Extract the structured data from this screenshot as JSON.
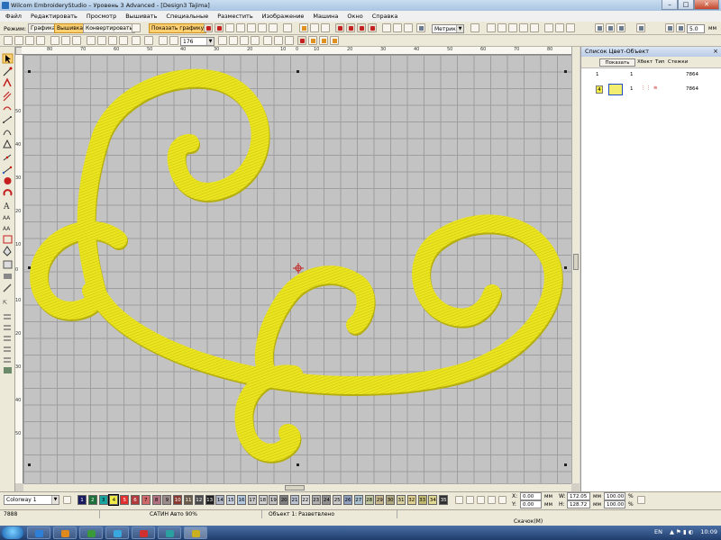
{
  "window": {
    "title": "Wilcom EmbroideryStudio – Уровень 3 Advanced - [Design3      Tajima]",
    "controls": [
      "–",
      "□",
      "✕"
    ]
  },
  "menu": [
    "Файл",
    "Редактировать",
    "Просмотр",
    "Вышивать",
    "Специальные",
    "Разместить",
    "Изображение",
    "Машина",
    "Окно",
    "Справка"
  ],
  "toolbar": {
    "mode_label": "Режим:",
    "modes": [
      "Графика",
      "Вышивка",
      "Конвертировать"
    ],
    "active_mode": "Вышивка",
    "show_graphics": "Показать графику",
    "zoom_value": "176",
    "units": "Метрика",
    "units_suffix": "мм",
    "units_value": "5.0"
  },
  "rulers": {
    "top": [
      "80",
      "70",
      "60",
      "50",
      "40",
      "30",
      "20",
      "10",
      "0",
      "10",
      "20",
      "30",
      "40",
      "50",
      "60",
      "70",
      "80"
    ],
    "left": [
      "50",
      "40",
      "30",
      "20",
      "10",
      "0",
      "10",
      "20",
      "30",
      "40",
      "50"
    ]
  },
  "right_panel": {
    "title": "Список Цвет-Объект",
    "show_button": "Показать",
    "columns": [
      "Хбект",
      "Тип",
      "Стежки"
    ],
    "rows": [
      {
        "col1": "1",
        "col2": "1",
        "stitches": "7864"
      },
      {
        "swatch": "4",
        "col2": "1",
        "stitches": "7864"
      }
    ]
  },
  "colorbar": {
    "colorway": "Colorway 1",
    "chips": [
      "1",
      "2",
      "3",
      "4",
      "5",
      "6",
      "7",
      "8",
      "9",
      "10",
      "11",
      "12",
      "13",
      "14",
      "15",
      "16",
      "17",
      "18",
      "19",
      "20",
      "21",
      "22",
      "23",
      "24",
      "25",
      "26",
      "27",
      "28",
      "29",
      "30",
      "31",
      "32",
      "33",
      "34",
      "35"
    ],
    "chip_colors": [
      "#1a1a60",
      "#1f6f3a",
      "#1aa5a0",
      "#f2ec4a",
      "#e03030",
      "#b23a3a",
      "#d06a6a",
      "#b07080",
      "#9a8a8a",
      "#8a3a30",
      "#6a5a48",
      "#4a4a4a",
      "#202020",
      "#b0b8c8",
      "#c8d0e0",
      "#b0c8e0",
      "#c8c8c8",
      "#d0d0d0",
      "#c0c0c0",
      "#808080",
      "#b8c0d0",
      "#d8d8d8",
      "#b0b0b0",
      "#909090",
      "#c8c8c8",
      "#90a0c0",
      "#a8c0d0",
      "#c0c8a0",
      "#c8b890",
      "#b0a880",
      "#d8d0a0",
      "#e0d090",
      "#c0b870",
      "#e0d890",
      "#303030"
    ],
    "x_label": "X:",
    "x_value": "0.00",
    "x_unit": "мм",
    "y_label": "Y:",
    "y_value": "0.00",
    "y_unit": "мм",
    "w_label": "W:",
    "w_value": "172.05",
    "w_unit": "мм",
    "h_label": "H:",
    "h_value": "128.72",
    "h_unit": "мм",
    "scale_w": "100.00",
    "scale_h": "100.00",
    "pct": "%"
  },
  "status": {
    "stitches": "7888",
    "stitch_type": "САТИН Авто 90%",
    "object": "Объект 1: Разветвлено",
    "hint": "Скачок(М)"
  },
  "taskbar": {
    "lang": "EN",
    "time": "10:09",
    "app_colors": [
      "#2d7fd8",
      "#e08a1e",
      "#3a9a3a",
      "#3aa8e0",
      "#d03030",
      "#2aa0a0",
      "#c8b020"
    ]
  },
  "design": {
    "thread_color": "#e8e21e",
    "thread_shadow": "#b5ae10"
  }
}
